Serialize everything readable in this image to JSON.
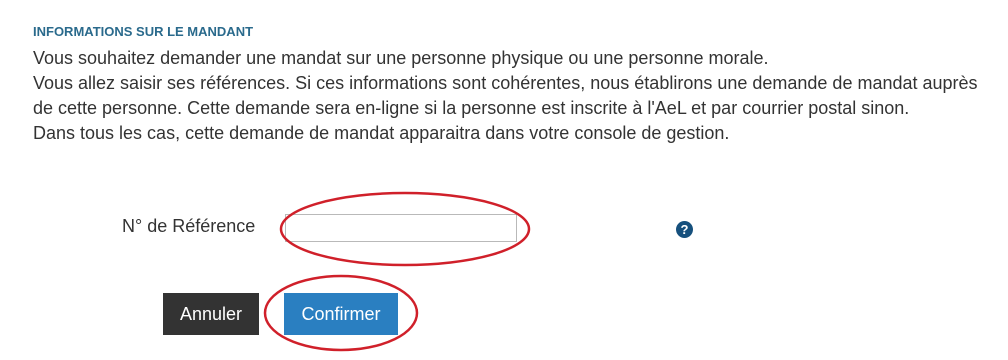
{
  "section": {
    "title": "INFORMATIONS SUR LE MANDANT"
  },
  "intro": {
    "paragraphs": [
      "Vous souhaitez demander une mandat sur une personne physique ou une personne morale.",
      "Vous allez saisir ses références. Si ces informations sont cohérentes, nous établirons une demande de mandat auprès de cette personne. Cette demande sera en-ligne si la personne est inscrite à l'AeL et par courrier postal sinon.",
      "Dans tous les cas, cette demande de mandat apparaitra dans votre console de gestion."
    ]
  },
  "form": {
    "reference_label": "N° de Référence",
    "reference_value": "",
    "help_icon": "question-circle-icon",
    "help_glyph": "?"
  },
  "buttons": {
    "cancel_label": "Annuler",
    "confirm_label": "Confirmer"
  },
  "colors": {
    "title": "#2a6a8c",
    "cancel_bg": "#333333",
    "confirm_bg": "#2a7fc1",
    "help_icon": "#16507d",
    "annotation": "#d0202a"
  }
}
